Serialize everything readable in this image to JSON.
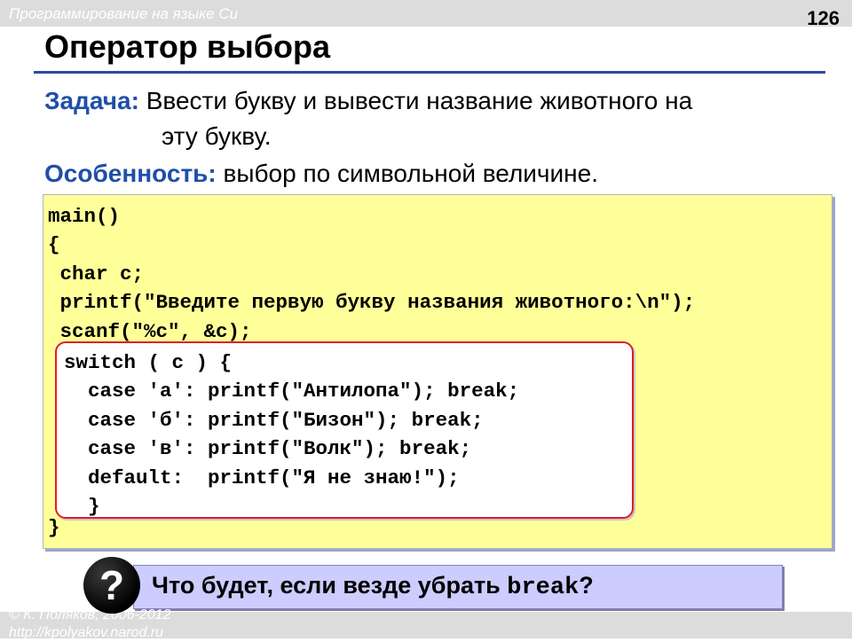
{
  "header": {
    "course": "Программирование на языке Си",
    "page_number": "126"
  },
  "slide": {
    "title": "Оператор выбора",
    "task_label": "Задача:",
    "task_line1": " Ввести букву и вывести название животного на",
    "task_line2": "эту букву.",
    "feature_label": "Особенность:",
    "feature_text": " выбор по символьной величине."
  },
  "code": {
    "top": "main()\n{\n char c;\n printf(\"Введите первую букву названия животного:\\n\");\n scanf(\"%c\", &c);",
    "switch": "switch ( c ) {\n  case 'а': printf(\"Антилопа\"); break;\n  case 'б': printf(\"Бизон\"); break;\n  case 'в': printf(\"Волк\"); break;\n  default:  printf(\"Я не знаю!\");\n  }",
    "bottom": "}"
  },
  "question": {
    "icon_symbol": "?",
    "text_before": "Что будет, если везде убрать ",
    "keyword": "break",
    "text_after": "?"
  },
  "footer": {
    "copyright": "© К. Поляков, 2006-2012",
    "url": "http://kpolyakov.narod.ru"
  },
  "colors": {
    "accent_blue": "#1f4fa8",
    "code_bg": "#ffff99",
    "highlight_border": "#e01d25",
    "question_bg": "#ccccff"
  },
  "icons": {
    "question": "question-circle-icon"
  }
}
